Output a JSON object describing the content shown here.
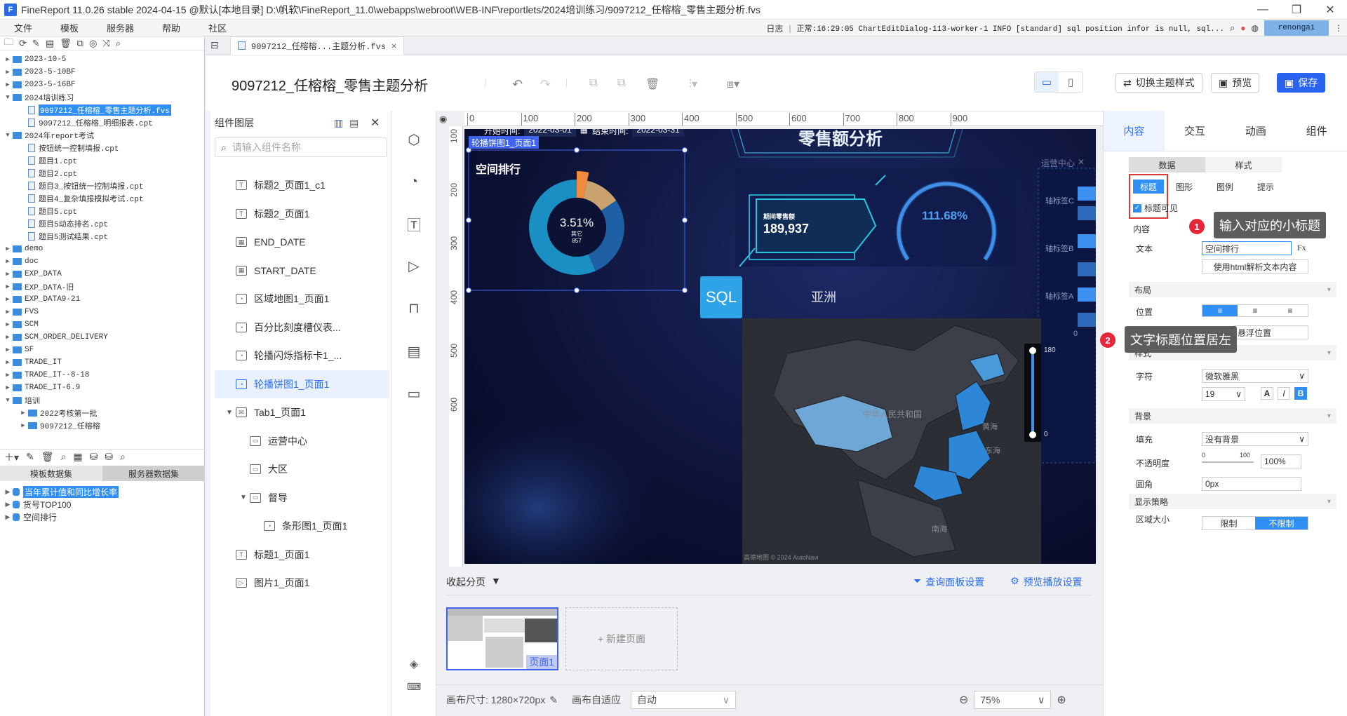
{
  "window": {
    "title": "FineReport 11.0.26 stable 2024-04-15 @默认[本地目录]    D:\\帆软\\FineReport_11.0\\webapps\\webroot\\WEB-INF\\reportlets/2024培训练习/9097212_任榕榕_零售主题分析.fvs"
  },
  "menu": {
    "items": [
      "文件",
      "模板",
      "服务器",
      "帮助",
      "社区"
    ],
    "log_label": "日志",
    "log_text": "正常:16:29:05 ChartEditDialog-113-worker-1 INFO [standard] sql position infor is null, sql...",
    "user": "renongai"
  },
  "tree": {
    "items": [
      {
        "label": "2023-10-5",
        "level": 0,
        "type": "folder"
      },
      {
        "label": "2023-5-10BF",
        "level": 0,
        "type": "folder"
      },
      {
        "label": "2023-5-16BF",
        "level": 0,
        "type": "folder"
      },
      {
        "label": "2024培训练习",
        "level": 0,
        "type": "folder",
        "open": true
      },
      {
        "label": "9097212_任榕榕_零售主题分析.fvs",
        "level": 1,
        "type": "file",
        "selected": true
      },
      {
        "label": "9097212_任榕榕_明细报表.cpt",
        "level": 1,
        "type": "file"
      },
      {
        "label": "2024年report考试",
        "level": 0,
        "type": "folder",
        "open": true
      },
      {
        "label": "按钮统一控制填报.cpt",
        "level": 1,
        "type": "file"
      },
      {
        "label": "题目1.cpt",
        "level": 1,
        "type": "file"
      },
      {
        "label": "题目2.cpt",
        "level": 1,
        "type": "file"
      },
      {
        "label": "题目3_按钮统一控制填报.cpt",
        "level": 1,
        "type": "file"
      },
      {
        "label": "题目4_复杂填报模拟考试.cpt",
        "level": 1,
        "type": "file"
      },
      {
        "label": "题目5.cpt",
        "level": 1,
        "type": "file"
      },
      {
        "label": "题目5动态排名.cpt",
        "level": 1,
        "type": "file"
      },
      {
        "label": "题目5测试结果.cpt",
        "level": 1,
        "type": "file"
      },
      {
        "label": "demo",
        "level": 0,
        "type": "folder"
      },
      {
        "label": "doc",
        "level": 0,
        "type": "folder"
      },
      {
        "label": "EXP_DATA",
        "level": 0,
        "type": "folder"
      },
      {
        "label": "EXP_DATA-旧",
        "level": 0,
        "type": "folder"
      },
      {
        "label": "EXP_DATA9-21",
        "level": 0,
        "type": "folder"
      },
      {
        "label": "FVS",
        "level": 0,
        "type": "folder"
      },
      {
        "label": "SCM",
        "level": 0,
        "type": "folder"
      },
      {
        "label": "SCM_ORDER_DELIVERY",
        "level": 0,
        "type": "folder"
      },
      {
        "label": "SF",
        "level": 0,
        "type": "folder"
      },
      {
        "label": "TRADE_IT",
        "level": 0,
        "type": "folder"
      },
      {
        "label": "TRADE_IT--8-18",
        "level": 0,
        "type": "folder"
      },
      {
        "label": "TRADE_IT-6.9",
        "level": 0,
        "type": "folder"
      },
      {
        "label": "培训",
        "level": 0,
        "type": "folder",
        "open": true
      },
      {
        "label": "2022考核第一批",
        "level": 1,
        "type": "folder"
      },
      {
        "label": "9097212_任榕榕",
        "level": 1,
        "type": "folder"
      }
    ]
  },
  "datasets": {
    "tab_template": "模板数据集",
    "tab_server": "服务器数据集",
    "items": [
      {
        "label": "当年累计值和同比增长率",
        "selected": true
      },
      {
        "label": "货号TOP100"
      },
      {
        "label": "空间排行"
      }
    ]
  },
  "filetab": {
    "label": "9097212_任榕榕...主题分析.fvs"
  },
  "header": {
    "page_title": "9097212_任榕榕_零售主题分析",
    "theme_btn": "切换主题样式",
    "preview_btn": "预览",
    "save_btn": "保存"
  },
  "components": {
    "title": "组件图层",
    "search_placeholder": "请输入组件名称",
    "layers": [
      {
        "label": "标题2_页面1_c1",
        "icon": "text-icon",
        "indent": 0
      },
      {
        "label": "标题2_页面1",
        "icon": "text-icon",
        "indent": 0
      },
      {
        "label": "END_DATE",
        "icon": "date-icon",
        "indent": 0
      },
      {
        "label": "START_DATE",
        "icon": "date-icon",
        "indent": 0
      },
      {
        "label": "区域地图1_页面1",
        "icon": "chart-icon",
        "indent": 0
      },
      {
        "label": "百分比刻度槽仪表...",
        "icon": "chart-icon",
        "indent": 0
      },
      {
        "label": "轮播闪烁指标卡1_...",
        "icon": "chart-icon",
        "indent": 0
      },
      {
        "label": "轮播饼图1_页面1",
        "icon": "chart-icon",
        "indent": 0,
        "selected": true
      },
      {
        "label": "Tab1_页面1",
        "icon": "tab-icon",
        "indent": 0,
        "expand": true
      },
      {
        "label": "运营中心",
        "icon": "folder-icon",
        "indent": 1
      },
      {
        "label": "大区",
        "icon": "folder-icon",
        "indent": 1
      },
      {
        "label": "督导",
        "icon": "folder-icon",
        "indent": 1,
        "expand": true
      },
      {
        "label": "条形图1_页面1",
        "icon": "chart-icon",
        "indent": 2
      },
      {
        "label": "标题1_页面1",
        "icon": "text-icon",
        "indent": 0
      },
      {
        "label": "图片1_页面1",
        "icon": "image-icon",
        "indent": 0
      }
    ]
  },
  "canvas": {
    "ruler_x": [
      "0",
      "100",
      "200",
      "300",
      "400",
      "500",
      "600",
      "700",
      "800",
      "900"
    ],
    "ruler_y": [
      "100",
      "200",
      "300",
      "400",
      "500",
      "600"
    ],
    "dashboard_title": "零售额分析",
    "start_label": "开始时间:",
    "start_value": "2022-03-01",
    "end_label": "结束时间:",
    "end_value": "2022-03-31",
    "selected_tag": "轮播饼图1_页面1",
    "pie_title": "空间排行",
    "pie_pct": "3.51%",
    "pie_sub": "其它",
    "pie_val": "857",
    "card_label": "期间零售额",
    "card_value": "189,937",
    "gauge_value": "111.68%",
    "tab_title": "运营中心",
    "bar_labels": [
      "轴标签C",
      "轴标签B",
      "轴标签A"
    ],
    "bar_zero": "0",
    "map_region": "亚洲",
    "sql_logo": "SQL",
    "map_labels": [
      "中华人民共和国",
      "黄海",
      "东海",
      "南海"
    ],
    "legend_max": "180",
    "legend_min": "0",
    "map_footer": "高德地图 © 2024 AutoNavi"
  },
  "pager": {
    "collapse": "收起分页",
    "query_settings": "查询面板设置",
    "preview_settings": "预览播放设置",
    "page_label": "页面1",
    "new_page": "+ 新建页面"
  },
  "footer": {
    "canvas_size": "画布尺寸: 1280×720px",
    "auto_label": "画布自适应",
    "auto_value": "自动",
    "zoom": "75%"
  },
  "props": {
    "tabs": [
      "内容",
      "交互",
      "动画",
      "组件"
    ],
    "subtabs": [
      "数据",
      "样式"
    ],
    "style_tabs": [
      "标题",
      "图形",
      "图例",
      "提示"
    ],
    "title_visible": "标题可见",
    "content_label": "内容",
    "text_label": "文本",
    "text_value": "空间排行",
    "fx": "Fx",
    "html_btn": "使用html解析文本内容",
    "layout_section": "布局",
    "position_label": "位置",
    "float_label": "悬浮位置",
    "style_section": "样式",
    "font_label": "字符",
    "font_value": "微软雅黑",
    "size_value": "19",
    "bg_section": "背景",
    "fill_label": "填充",
    "fill_value": "没有背景",
    "opacity_label": "不透明度",
    "opacity_min": "0",
    "opacity_max": "100",
    "opacity_value": "100%",
    "radius_label": "圆角",
    "radius_value": "0px",
    "display_section": "显示策略",
    "area_label": "区域大小",
    "area_opt1": "限制",
    "area_opt2": "不限制"
  },
  "annotations": [
    {
      "num": "1",
      "text": "输入对应的小标题"
    },
    {
      "num": "2",
      "text": "文字标题位置居左"
    }
  ],
  "chart_data": {
    "type": "pie",
    "title": "空间排行",
    "slices": [
      {
        "label": "其它",
        "value": 3.51,
        "color": "#f08a3c"
      },
      {
        "label": "",
        "value": 12,
        "color": "#c9a270"
      },
      {
        "label": "",
        "value": 28,
        "color": "#1f5fa6"
      },
      {
        "label": "",
        "value": 56.49,
        "color": "#1a8fc4"
      }
    ]
  }
}
